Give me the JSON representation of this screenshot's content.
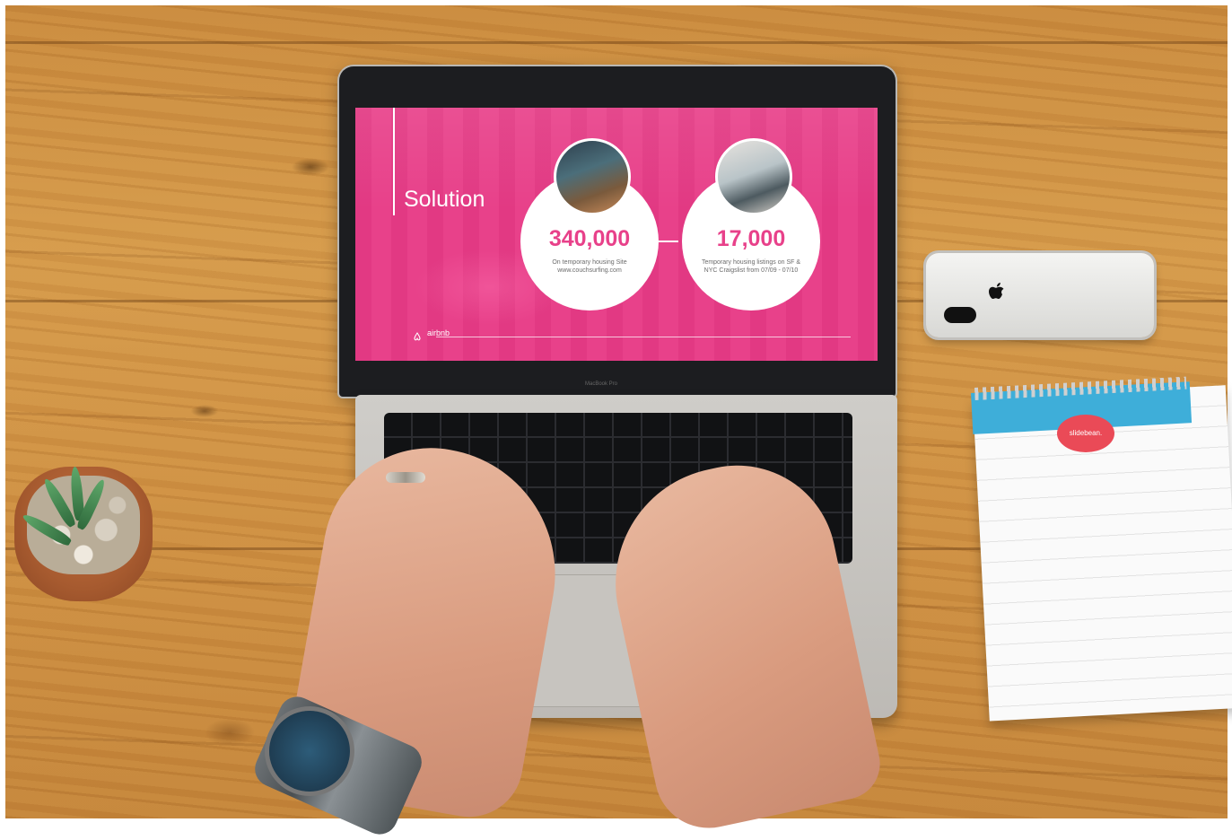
{
  "slide": {
    "title": "Solution",
    "stat1": {
      "value": "340,000",
      "description": "On temporary housing Site www.couchsurfing.com"
    },
    "stat2": {
      "value": "17,000",
      "description": "Temporary housing listings on SF & NYC Craigslist from 07/09 - 07/10"
    },
    "brand": "airbnb",
    "accent_color": "#e8418a"
  },
  "laptop": {
    "model_label": "MacBook Pro"
  },
  "notepad": {
    "badge": "slidebean."
  },
  "icons": [
    "airbnb-logo-icon",
    "apple-logo-icon"
  ]
}
